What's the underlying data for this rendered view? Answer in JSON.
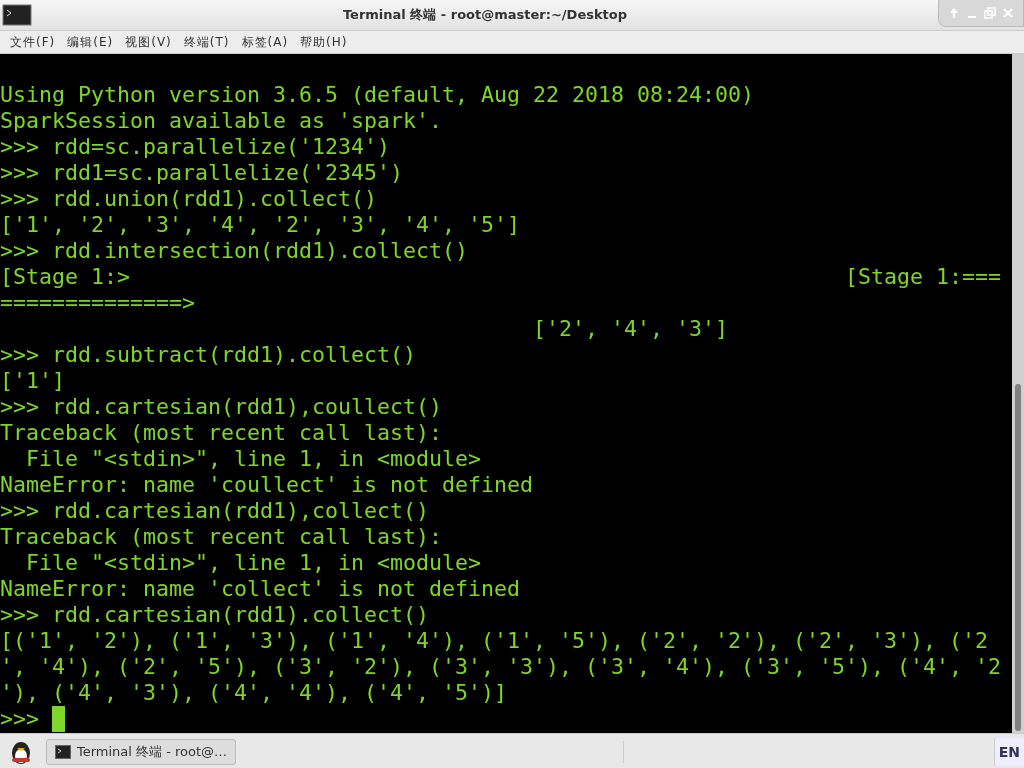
{
  "window": {
    "title": "Terminal 终端 - root@master:~/Desktop"
  },
  "menu": [
    "文件(F)",
    "编辑(E)",
    "视图(V)",
    "终端(T)",
    "标签(A)",
    "帮助(H)"
  ],
  "terminal": {
    "lines": [
      "Using Python version 3.6.5 (default, Aug 22 2018 08:24:00)",
      "SparkSession available as 'spark'.",
      ">>> rdd=sc.parallelize('1234')",
      ">>> rdd1=sc.parallelize('2345')",
      ">>> rdd.union(rdd1).collect()",
      "['1', '2', '3', '4', '2', '3', '4', '5']",
      ">>> rdd.intersection(rdd1).collect()",
      "[Stage 1:>                                                       [Stage 1:===",
      "==============>",
      "                                         ['2', '4', '3']",
      ">>> rdd.subtract(rdd1).collect()",
      "['1']",
      ">>> rdd.cartesian(rdd1),coullect()",
      "Traceback (most recent call last):",
      "  File \"<stdin>\", line 1, in <module>",
      "NameError: name 'coullect' is not defined",
      ">>> rdd.cartesian(rdd1),collect()",
      "Traceback (most recent call last):",
      "  File \"<stdin>\", line 1, in <module>",
      "NameError: name 'collect' is not defined",
      ">>> rdd.cartesian(rdd1).collect()",
      "[('1', '2'), ('1', '3'), ('1', '4'), ('1', '5'), ('2', '2'), ('2', '3'), ('2",
      "', '4'), ('2', '5'), ('3', '2'), ('3', '3'), ('3', '4'), ('3', '5'), ('4', '2",
      "'), ('4', '3'), ('4', '4'), ('4', '5')]"
    ],
    "prompt": ">>>"
  },
  "taskbar": {
    "task": "Terminal 终端 - root@…",
    "keyboard": "EN"
  }
}
